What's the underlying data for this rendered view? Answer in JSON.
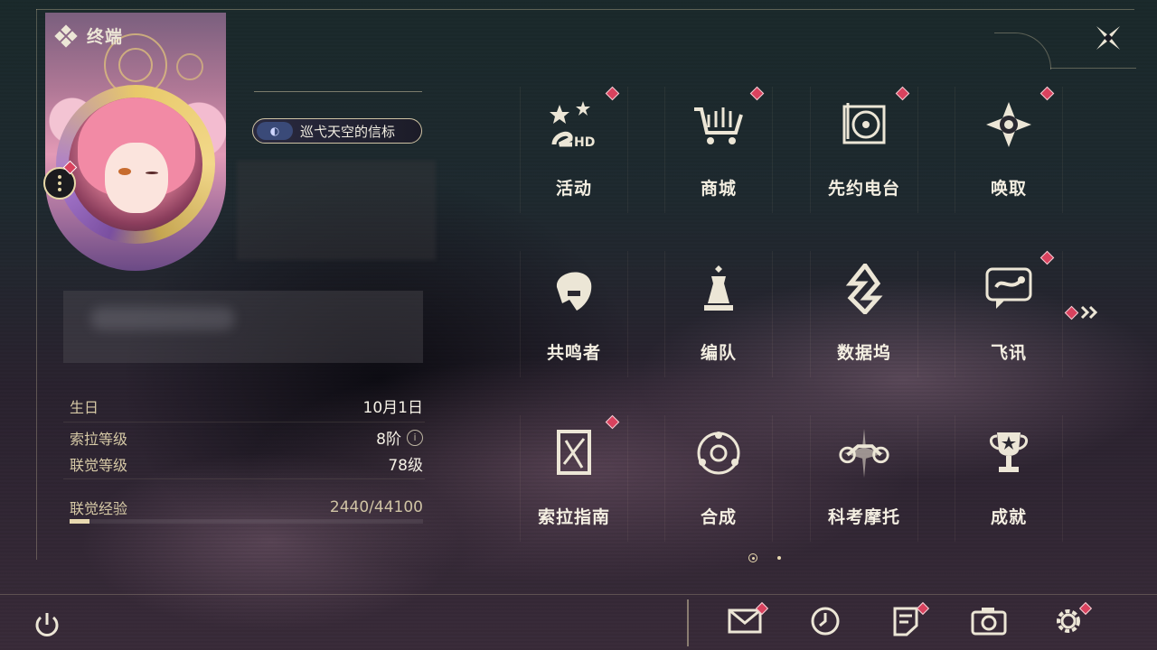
{
  "header": {
    "title": "终端",
    "icon": "diamond-cluster-icon"
  },
  "profile": {
    "title_badge": "巡弋天空的信标",
    "stats": [
      {
        "label": "生日",
        "value": "10月1日"
      },
      {
        "label": "索拉等级",
        "value": "8阶"
      },
      {
        "label": "联觉等级",
        "value": "78级"
      },
      {
        "label": "联觉经验",
        "value": "2440/44100"
      }
    ],
    "exp_progress": 0.0553,
    "info_glyph": "i"
  },
  "menu": {
    "items": [
      {
        "label": "活动",
        "icon": "event-2hd-icon",
        "badge": true
      },
      {
        "label": "商城",
        "icon": "shop-cart-crown-icon",
        "badge": true
      },
      {
        "label": "先约电台",
        "icon": "radio-record-icon",
        "badge": true
      },
      {
        "label": "唤取",
        "icon": "summon-compass-icon",
        "badge": true
      },
      {
        "label": "共鸣者",
        "icon": "resonator-head-icon",
        "badge": false
      },
      {
        "label": "编队",
        "icon": "team-chess-icon",
        "badge": false
      },
      {
        "label": "数据坞",
        "icon": "data-dock-icon",
        "badge": false
      },
      {
        "label": "飞讯",
        "icon": "message-chat-icon",
        "badge": true
      },
      {
        "label": "索拉指南",
        "icon": "guide-book-icon",
        "badge": true
      },
      {
        "label": "合成",
        "icon": "synthesis-icon",
        "badge": false
      },
      {
        "label": "科考摩托",
        "icon": "motorbike-icon",
        "badge": false
      },
      {
        "label": "成就",
        "icon": "trophy-icon",
        "badge": false
      }
    ],
    "page": {
      "current": 1,
      "total": 2
    }
  },
  "bottom_bar": {
    "buttons": [
      {
        "name": "mail",
        "icon": "mail-icon",
        "badge": true
      },
      {
        "name": "clock",
        "icon": "clock-icon",
        "badge": false
      },
      {
        "name": "notice",
        "icon": "notice-icon",
        "badge": true
      },
      {
        "name": "camera",
        "icon": "camera-icon",
        "badge": false
      },
      {
        "name": "settings",
        "icon": "gear-icon",
        "badge": true
      }
    ]
  },
  "colors": {
    "accent": "#e8d9b0",
    "badge": "#d9425e",
    "text": "#f4efe2"
  }
}
